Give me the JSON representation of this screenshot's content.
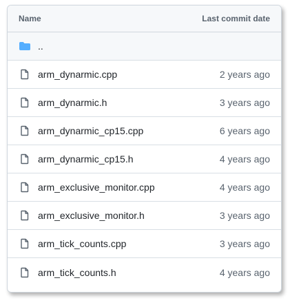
{
  "table": {
    "header": {
      "name_label": "Name",
      "date_label": "Last commit date"
    },
    "parent": {
      "label": "..",
      "icon": "folder-icon",
      "icon_color": "#54aeff"
    },
    "files": [
      {
        "name": "arm_dynarmic.cpp",
        "date": "2 years ago",
        "icon": "file-icon"
      },
      {
        "name": "arm_dynarmic.h",
        "date": "3 years ago",
        "icon": "file-icon"
      },
      {
        "name": "arm_dynarmic_cp15.cpp",
        "date": "6 years ago",
        "icon": "file-icon"
      },
      {
        "name": "arm_dynarmic_cp15.h",
        "date": "4 years ago",
        "icon": "file-icon"
      },
      {
        "name": "arm_exclusive_monitor.cpp",
        "date": "4 years ago",
        "icon": "file-icon"
      },
      {
        "name": "arm_exclusive_monitor.h",
        "date": "3 years ago",
        "icon": "file-icon"
      },
      {
        "name": "arm_tick_counts.cpp",
        "date": "3 years ago",
        "icon": "file-icon"
      },
      {
        "name": "arm_tick_counts.h",
        "date": "4 years ago",
        "icon": "file-icon"
      }
    ]
  }
}
